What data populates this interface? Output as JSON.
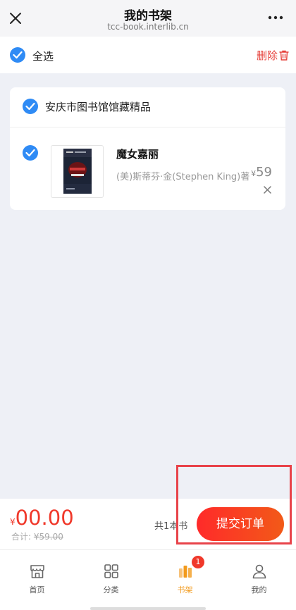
{
  "header": {
    "title": "我的书架",
    "url": "tcc-book.interlib.cn",
    "close_icon": "close-icon",
    "more_icon": "more-icon"
  },
  "select_bar": {
    "select_all_label": "全选",
    "delete_label": "删除",
    "delete_icon": "trash-icon"
  },
  "store": {
    "name": "安庆市图书馆馆藏精品",
    "items": [
      {
        "title": "魔女嘉丽",
        "author": "(美)斯蒂芬·金(Stephen King)著",
        "currency": "¥",
        "price": "59",
        "selected": true
      }
    ]
  },
  "checkout": {
    "currency": "¥",
    "total": "00.00",
    "subtotal_label": "合计:",
    "subtotal_value": "¥59.00",
    "count_text": "共1本书",
    "submit_label": "提交订单"
  },
  "tabbar": {
    "tabs": [
      {
        "label": "首页",
        "icon": "home-icon",
        "active": false
      },
      {
        "label": "分类",
        "icon": "category-icon",
        "active": false
      },
      {
        "label": "书架",
        "icon": "bookshelf-icon",
        "active": true,
        "badge": "1"
      },
      {
        "label": "我的",
        "icon": "user-icon",
        "active": false
      }
    ]
  },
  "colors": {
    "accent_blue": "#2f8bf5",
    "price_red": "#f0382a",
    "tab_active": "#f29a1c",
    "highlight_box": "#e8434a"
  }
}
